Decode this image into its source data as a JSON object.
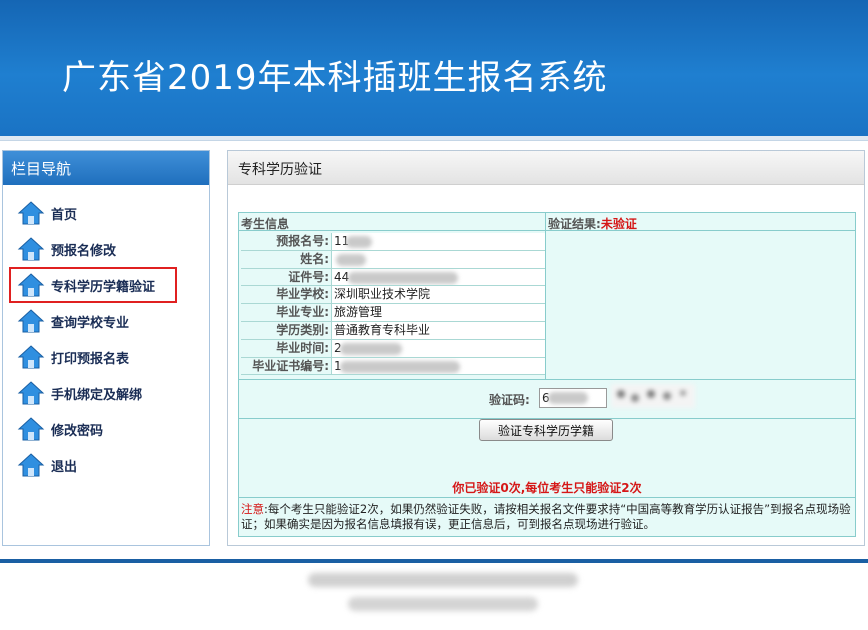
{
  "header": {
    "title": "广东省2019年本科插班生报名系统"
  },
  "sidebar": {
    "title": "栏目导航",
    "items": [
      {
        "label": "首页"
      },
      {
        "label": "预报名修改"
      },
      {
        "label": "专科学历学籍验证"
      },
      {
        "label": "查询学校专业"
      },
      {
        "label": "打印预报名表"
      },
      {
        "label": "手机绑定及解绑"
      },
      {
        "label": "修改密码"
      },
      {
        "label": "退出"
      }
    ]
  },
  "main": {
    "title": "专科学历验证",
    "section_label": "考生信息",
    "result_label": "验证结果:",
    "result_value": "未验证",
    "fields": [
      {
        "label": "预报名号:",
        "value": "11"
      },
      {
        "label": "姓名:",
        "value": ""
      },
      {
        "label": "证件号:",
        "value": "44"
      },
      {
        "label": "毕业学校:",
        "value": "深圳职业技术学院"
      },
      {
        "label": "毕业专业:",
        "value": "旅游管理"
      },
      {
        "label": "学历类别:",
        "value": "普通教育专科毕业"
      },
      {
        "label": "毕业时间:",
        "value": "2"
      },
      {
        "label": "毕业证书编号:",
        "value": "1"
      }
    ],
    "captcha_label": "验证码:",
    "captcha_value": "6",
    "verify_button": "验证专科学历学籍",
    "verify_count": "你已验证0次,每位考生只能验证2次",
    "notice_tag": "注意",
    "notice_text": ":每个考生只能验证2次，如果仍然验证失败，请按相关报名文件要求持“中国高等教育学历认证报告”到报名点现场验证；如果确实是因为报名信息填报有误，更正信息后，可到报名点现场进行验证。"
  },
  "colors": {
    "header_blue": "#1f7fd0",
    "alert_red": "#d51717",
    "panel_cyan": "#e6faf8"
  }
}
